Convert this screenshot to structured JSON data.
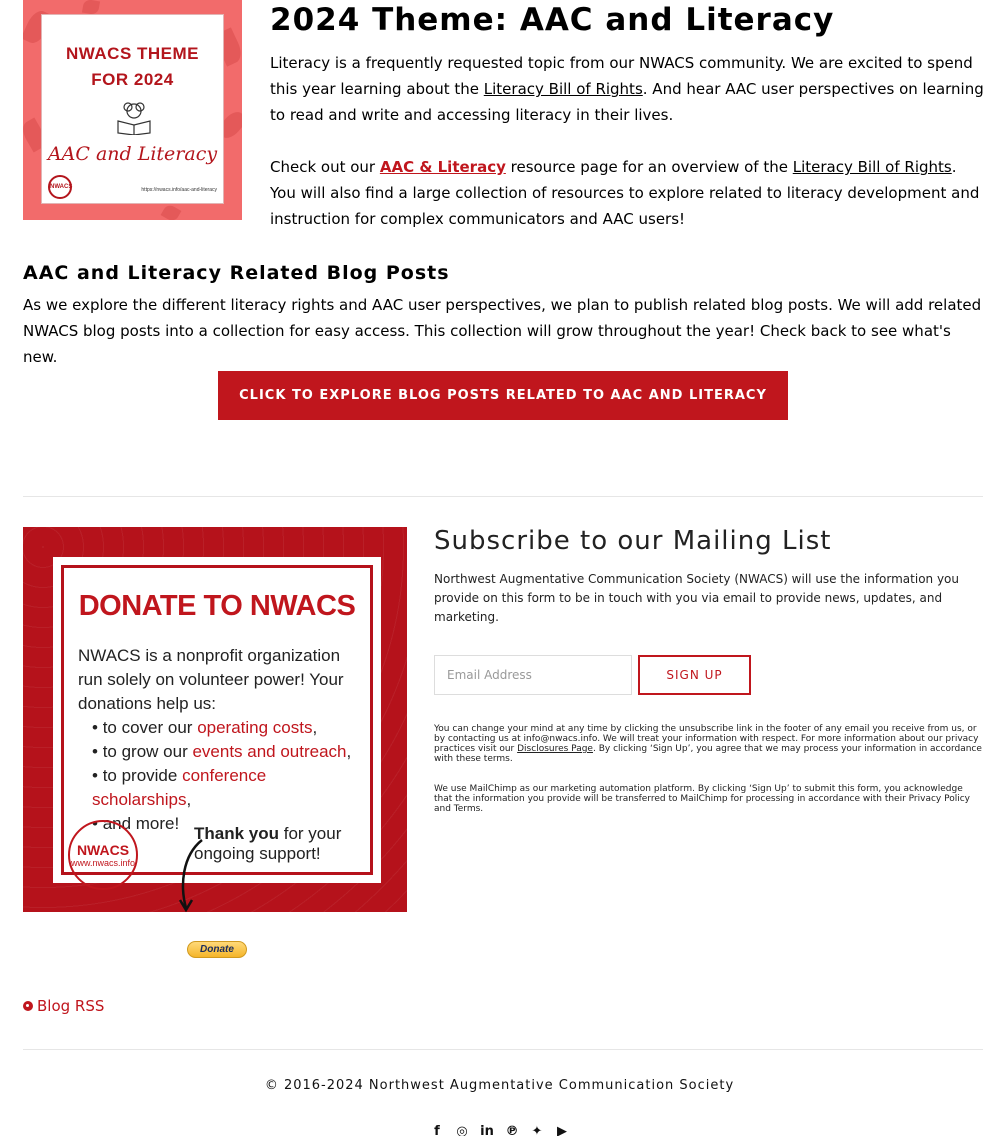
{
  "theme_image": {
    "title_line1": "NWACS THEME",
    "title_line2": "FOR 2024",
    "script_text": "AAC and Literacy",
    "logo_text": "NWACS",
    "url_text": "https://nwacs.info/aac-and-literacy"
  },
  "theme": {
    "heading": "2024 Theme: AAC and Literacy",
    "p1_a": "Literacy is a frequently requested topic from our NWACS community. We are excited to spend this year learning about the ",
    "p1_link": "Literacy Bill of Rights",
    "p1_b": ". And hear AAC user perspectives on learning to read and write and accessing literacy in their lives.",
    "p2_a": "Check out our ",
    "p2_link1": "AAC & Literacy",
    "p2_b": " resource page for an overview of the ",
    "p2_link2": "Literacy Bill of Rights",
    "p2_c": ". You will also find a large collection of resources to explore related to literacy development and instruction for complex communicators and AAC users!"
  },
  "blog": {
    "heading": "AAC and Literacy Related Blog Posts",
    "text": "As we explore the different literacy rights and AAC user perspectives, we plan to publish related blog posts. We will add related NWACS blog posts into a collection for easy access. This collection will grow throughout the year! Check back to see what's new.",
    "cta_label": "CLICK TO EXPLORE BLOG POSTS RELATED TO AAC AND LITERACY"
  },
  "donate_image": {
    "title": "DONATE TO NWACS",
    "body": "NWACS is a nonprofit organization run solely on volunteer power! Your donations help us:",
    "items": [
      {
        "pre": "to cover our ",
        "red": "operating costs",
        "post": ","
      },
      {
        "pre": "to grow our ",
        "red": "events and outreach",
        "post": ","
      },
      {
        "pre": "to provide ",
        "red": "conference scholarships",
        "post": ","
      },
      {
        "pre": "and more!",
        "red": "",
        "post": ""
      }
    ],
    "thanks_bold": "Thank you",
    "thanks_rest1": " for your",
    "thanks_rest2": "ongoing support!",
    "logo_name": "NWACS",
    "logo_url": "www.nwacs.info"
  },
  "paypal": {
    "label": "Donate"
  },
  "subscribe": {
    "title": "Subscribe to our Mailing List",
    "description": "Northwest Augmentative Communication Society (NWACS) will use the information you provide on this form to be in touch with you via email to provide news, updates, and marketing.",
    "email_placeholder": "Email Address",
    "signup_label": "SIGN UP",
    "fine1_a": "You can change your mind at any time by clicking the unsubscribe link in the footer of any email you receive from us, or by contacting us at info@nwacs.info. We will treat your information with respect. For more information about our privacy practices visit our ",
    "fine1_link": "Disclosures Page",
    "fine1_b": ". By clicking ‘Sign Up’, you agree that we may process your information in accordance with these terms.",
    "fine2": "We use MailChimp as our marketing automation platform. By clicking ‘Sign Up’ to submit this form, you acknowledge that the information you provide will be transferred to MailChimp for processing in accordance with their Privacy Policy and Terms."
  },
  "rss": {
    "label": "Blog RSS",
    "icon": "rss-icon"
  },
  "footer": {
    "copyright": "© 2016-2024 Northwest Augmentative Communication Society",
    "social": [
      "facebook-icon",
      "instagram-icon",
      "linkedin-icon",
      "pinterest-icon",
      "twitter-icon",
      "youtube-icon"
    ]
  },
  "colors": {
    "accent": "#c0161d",
    "theme_bg": "#f26b6b"
  }
}
